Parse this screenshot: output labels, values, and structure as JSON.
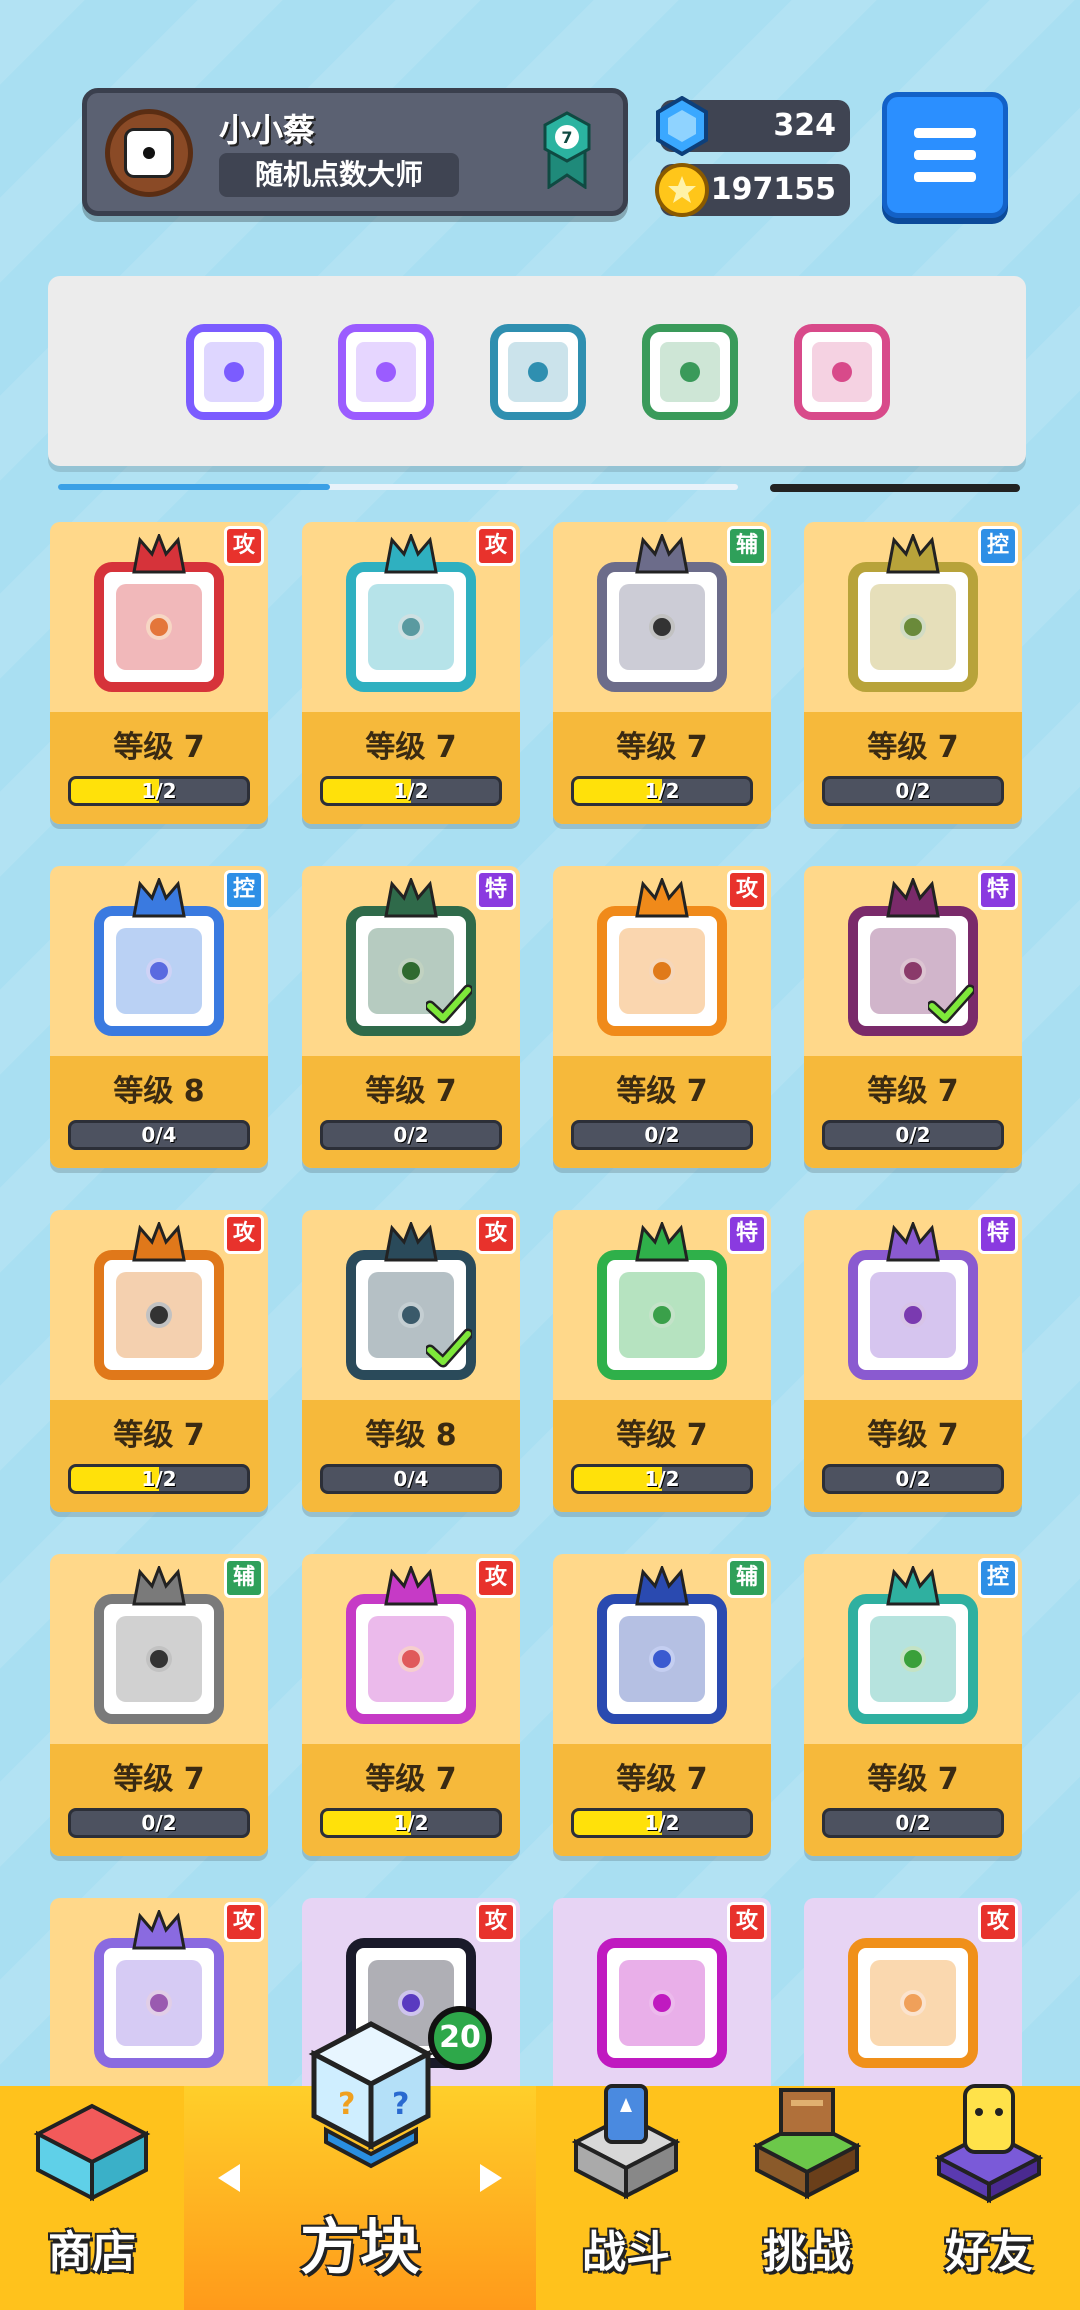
{
  "player": {
    "name": "小小蔡",
    "title": "随机点数大师",
    "rank": "7"
  },
  "currency": {
    "gems": "324",
    "coins": "197155"
  },
  "deck": {
    "slots": [
      {
        "color": "#7b5cff",
        "icon": "hands-die-icon"
      },
      {
        "color": "#9b5cff",
        "icon": "rainbow-die-icon"
      },
      {
        "color": "#2f8fb0",
        "icon": "vortex-die-icon"
      },
      {
        "color": "#3a9a5a",
        "icon": "pentagram-die-icon"
      },
      {
        "color": "#d84a8a",
        "icon": "cross-die-icon"
      }
    ]
  },
  "cards": [
    {
      "level": "等级 7",
      "progress": "1/2",
      "fill": 0.5,
      "tag": "攻",
      "tagColor": "#e8322c",
      "accent": "#d6333a",
      "pip": "#e4763a",
      "check": false,
      "locked": false
    },
    {
      "level": "等级 7",
      "progress": "1/2",
      "fill": 0.5,
      "tag": "攻",
      "tagColor": "#e8322c",
      "accent": "#2fb0c0",
      "pip": "#5a9aa0",
      "check": false,
      "locked": false
    },
    {
      "level": "等级 7",
      "progress": "1/2",
      "fill": 0.5,
      "tag": "辅",
      "tagColor": "#2fa05a",
      "accent": "#6c6c8a",
      "pip": "#333333",
      "check": false,
      "locked": false
    },
    {
      "level": "等级 7",
      "progress": "0/2",
      "fill": 0,
      "tag": "控",
      "tagColor": "#2e8fe6",
      "accent": "#b8a33a",
      "pip": "#6a8a3a",
      "check": false,
      "locked": false
    },
    {
      "level": "等级 8",
      "progress": "0/4",
      "fill": 0,
      "tag": "控",
      "tagColor": "#2e8fe6",
      "accent": "#3a7ae0",
      "pip": "#5a6ae0",
      "check": false,
      "locked": false
    },
    {
      "level": "等级 7",
      "progress": "0/2",
      "fill": 0,
      "tag": "特",
      "tagColor": "#8a3ae0",
      "accent": "#2f6a4a",
      "pip": "#2f6a2f",
      "check": true,
      "locked": false
    },
    {
      "level": "等级 7",
      "progress": "0/2",
      "fill": 0,
      "tag": "攻",
      "tagColor": "#e8322c",
      "accent": "#f08a1a",
      "pip": "#e07a1a",
      "check": false,
      "locked": false
    },
    {
      "level": "等级 7",
      "progress": "0/2",
      "fill": 0,
      "tag": "特",
      "tagColor": "#8a3ae0",
      "accent": "#7a2a6a",
      "pip": "#8a3a6a",
      "check": true,
      "locked": false
    },
    {
      "level": "等级 7",
      "progress": "1/2",
      "fill": 0.5,
      "tag": "攻",
      "tagColor": "#e8322c",
      "accent": "#e0781a",
      "pip": "#333333",
      "check": false,
      "locked": false
    },
    {
      "level": "等级 8",
      "progress": "0/4",
      "fill": 0,
      "tag": "攻",
      "tagColor": "#e8322c",
      "accent": "#2a4a5a",
      "pip": "#3a5a6a",
      "check": true,
      "locked": false
    },
    {
      "level": "等级 7",
      "progress": "1/2",
      "fill": 0.5,
      "tag": "特",
      "tagColor": "#8a3ae0",
      "accent": "#2fb04a",
      "pip": "#3aa04a",
      "check": false,
      "locked": false
    },
    {
      "level": "等级 7",
      "progress": "0/2",
      "fill": 0,
      "tag": "特",
      "tagColor": "#8a3ae0",
      "accent": "#8a5ad0",
      "pip": "#7a3ab0",
      "check": false,
      "locked": false
    },
    {
      "level": "等级 7",
      "progress": "0/2",
      "fill": 0,
      "tag": "辅",
      "tagColor": "#2fa05a",
      "accent": "#7a7a7a",
      "pip": "#333333",
      "check": false,
      "locked": false
    },
    {
      "level": "等级 7",
      "progress": "1/2",
      "fill": 0.5,
      "tag": "攻",
      "tagColor": "#e8322c",
      "accent": "#c63ac6",
      "pip": "#e05a5a",
      "check": false,
      "locked": false
    },
    {
      "level": "等级 7",
      "progress": "1/2",
      "fill": 0.5,
      "tag": "辅",
      "tagColor": "#2fa05a",
      "accent": "#2a4ab0",
      "pip": "#3a5ad0",
      "check": false,
      "locked": false
    },
    {
      "level": "等级 7",
      "progress": "0/2",
      "fill": 0,
      "tag": "控",
      "tagColor": "#2e8fe6",
      "accent": "#2fb0a0",
      "pip": "#3aa03a",
      "check": false,
      "locked": false
    },
    {
      "level": "",
      "progress": "",
      "fill": 0,
      "tag": "攻",
      "tagColor": "#e8322c",
      "accent": "#8a6ae0",
      "pip": "#9a5ab0",
      "check": false,
      "locked": false
    },
    {
      "level": "",
      "progress": "",
      "fill": 0,
      "tag": "攻",
      "tagColor": "#e8322c",
      "accent": "#1a1a2a",
      "pip": "#5a3ac0",
      "check": false,
      "locked": true
    },
    {
      "level": "",
      "progress": "",
      "fill": 0,
      "tag": "攻",
      "tagColor": "#e8322c",
      "accent": "#c01ac0",
      "pip": "#c01ac0",
      "check": false,
      "locked": true
    },
    {
      "level": "",
      "progress": "",
      "fill": 0,
      "tag": "攻",
      "tagColor": "#e8322c",
      "accent": "#f0901a",
      "pip": "#f0a05a",
      "check": false,
      "locked": true
    }
  ],
  "nav": {
    "shop": "商店",
    "dice": "方块",
    "battle": "战斗",
    "challenge": "挑战",
    "friends": "好友",
    "dice_badge": "20"
  }
}
